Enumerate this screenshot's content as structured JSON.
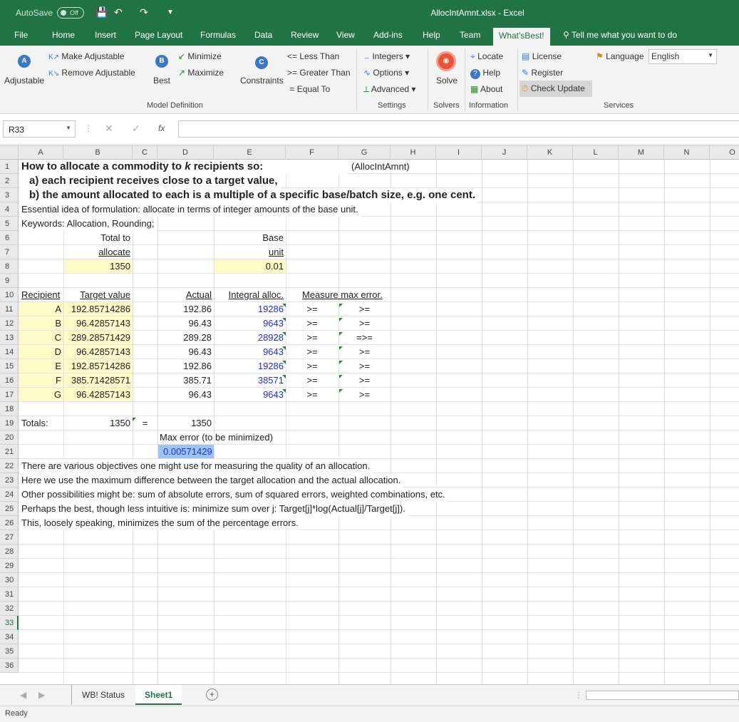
{
  "titlebar": {
    "autosave_label": "AutoSave",
    "autosave_state": "Off",
    "window_title": "AllocIntAmnt.xlsx  -  Excel"
  },
  "tabs": [
    "File",
    "Home",
    "Insert",
    "Page Layout",
    "Formulas",
    "Data",
    "Review",
    "View",
    "Add-ins",
    "Help",
    "Team",
    "What'sBest!"
  ],
  "active_tab": "What'sBest!",
  "tell_me": "Tell me what you want to do",
  "ribbon": {
    "adjustable": "Adjustable",
    "make_adjustable": "Make Adjustable",
    "remove_adjustable": "Remove Adjustable",
    "best": "Best",
    "minimize": "Minimize",
    "maximize": "Maximize",
    "constraints": "Constraints",
    "less_than": "Less Than",
    "greater_than": "Greater Than",
    "equal_to": "Equal To",
    "integers": "Integers",
    "options": "Options",
    "advanced": "Advanced",
    "solve": "Solve",
    "locate": "Locate",
    "help": "Help",
    "about": "About",
    "license": "License",
    "register": "Register",
    "check_update": "Check Update",
    "language_label": "Language",
    "language_value": "English",
    "groups": {
      "model_definition": "Model Definition",
      "settings": "Settings",
      "solvers": "Solvers",
      "information": "Information",
      "services": "Services"
    }
  },
  "formula_bar": {
    "name_box": "R33",
    "fx": "fx",
    "formula": ""
  },
  "columns": [
    "A",
    "B",
    "C",
    "D",
    "E",
    "F",
    "G",
    "H",
    "I",
    "J",
    "K",
    "L",
    "M",
    "N",
    "O"
  ],
  "sheet": {
    "r1_text": "How to allocate a commodity to k  recipients so:",
    "r1_note": "(AllocIntAmnt)",
    "r2": "a) each recipient receives close to a target value,",
    "r3": "b) the amount allocated to each is a multiple of a specific base/batch size, e.g. one cent.",
    "r4": "Essential idea of formulation:  allocate in terms of integer amounts of the base unit.",
    "r5": "Keywords:  Allocation, Rounding;",
    "total_label_1": "Total to",
    "total_label_2": "allocate",
    "total_value": "1350",
    "base_label_1": "Base",
    "base_label_2": "unit",
    "base_value": "0.01",
    "headers": {
      "recipient": "Recipient",
      "target": "Target value",
      "actual": "Actual",
      "integral": "Integral alloc.",
      "measure": "Measure max error."
    },
    "rows": [
      {
        "recipient": "A",
        "target": "192.85714286",
        "actual": "192.86",
        "integral": "19286",
        "f": ">=",
        "g": ">="
      },
      {
        "recipient": "B",
        "target": "96.42857143",
        "actual": "96.43",
        "integral": "9643",
        "f": ">=",
        "g": ">="
      },
      {
        "recipient": "C",
        "target": "289.28571429",
        "actual": "289.28",
        "integral": "28928",
        "f": ">=",
        "g": "=>="
      },
      {
        "recipient": "D",
        "target": "96.42857143",
        "actual": "96.43",
        "integral": "9643",
        "f": ">=",
        "g": ">="
      },
      {
        "recipient": "E",
        "target": "192.85714286",
        "actual": "192.86",
        "integral": "19286",
        "f": ">=",
        "g": ">="
      },
      {
        "recipient": "F",
        "target": "385.71428571",
        "actual": "385.71",
        "integral": "38571",
        "f": ">=",
        "g": ">="
      },
      {
        "recipient": "G",
        "target": "96.42857143",
        "actual": "96.43",
        "integral": "9643",
        "f": ">=",
        "g": ">="
      }
    ],
    "totals_label": "Totals:",
    "totals_target": "1350",
    "totals_eq": "=",
    "totals_actual": "1350",
    "max_error_label": "Max error (to be minimized)",
    "max_error_value": "0.00571429",
    "r22": "There are various objectives one might use for measuring the quality of an allocation.",
    "r23": "Here we use the maximum difference between the target allocation and the actual allocation.",
    "r24": "Other possibilities might be:  sum of absolute errors, sum of squared errors, weighted combinations, etc.",
    "r25": "Perhaps the best, though less intuitive is:  minimize sum over j: Target[j]*log(Actual[j]/Target[j]).",
    "r26": "This, loosely speaking, minimizes the sum of the percentage errors."
  },
  "sheet_tabs": [
    "WB! Status",
    "Sheet1"
  ],
  "active_sheet": "Sheet1",
  "status": "Ready",
  "colors": {
    "excel_green": "#217346",
    "input_yellow": "#fdfbc8",
    "selected_blue": "#9dc3f0",
    "integer_blue": "#1f2fd2"
  }
}
